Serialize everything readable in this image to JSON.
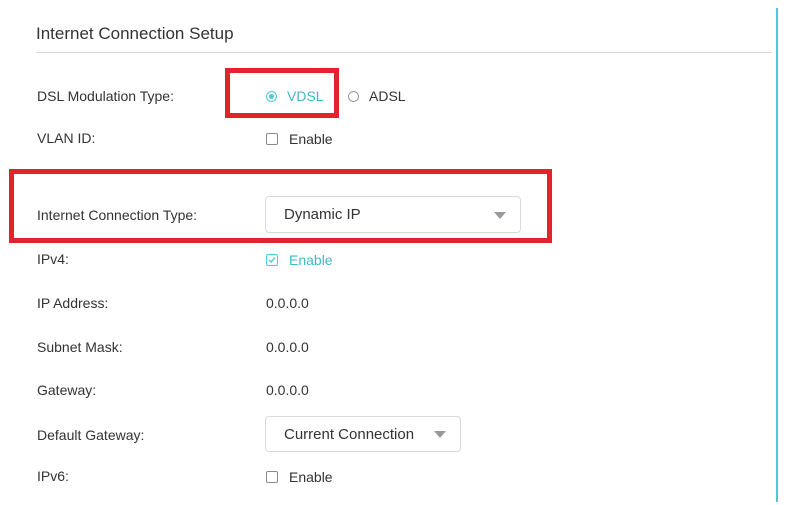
{
  "section": {
    "title": "Internet Connection Setup"
  },
  "dsl_modulation": {
    "label": "DSL Modulation Type:",
    "options": [
      {
        "label": "VDSL",
        "selected": true
      },
      {
        "label": "ADSL",
        "selected": false
      }
    ]
  },
  "vlan_id": {
    "label": "VLAN ID:",
    "checkbox_label": "Enable",
    "checked": false
  },
  "connection_type": {
    "label": "Internet Connection Type:",
    "value": "Dynamic IP"
  },
  "ipv4": {
    "label": "IPv4:",
    "checkbox_label": "Enable",
    "checked": true
  },
  "ip_address": {
    "label": "IP Address:",
    "value": "0.0.0.0"
  },
  "subnet_mask": {
    "label": "Subnet Mask:",
    "value": "0.0.0.0"
  },
  "gateway": {
    "label": "Gateway:",
    "value": "0.0.0.0"
  },
  "default_gateway": {
    "label": "Default Gateway:",
    "value": "Current Connection"
  },
  "ipv6": {
    "label": "IPv6:",
    "checkbox_label": "Enable",
    "checked": false
  },
  "colors": {
    "accent": "#4acbd6",
    "highlight": "#e3222c"
  }
}
